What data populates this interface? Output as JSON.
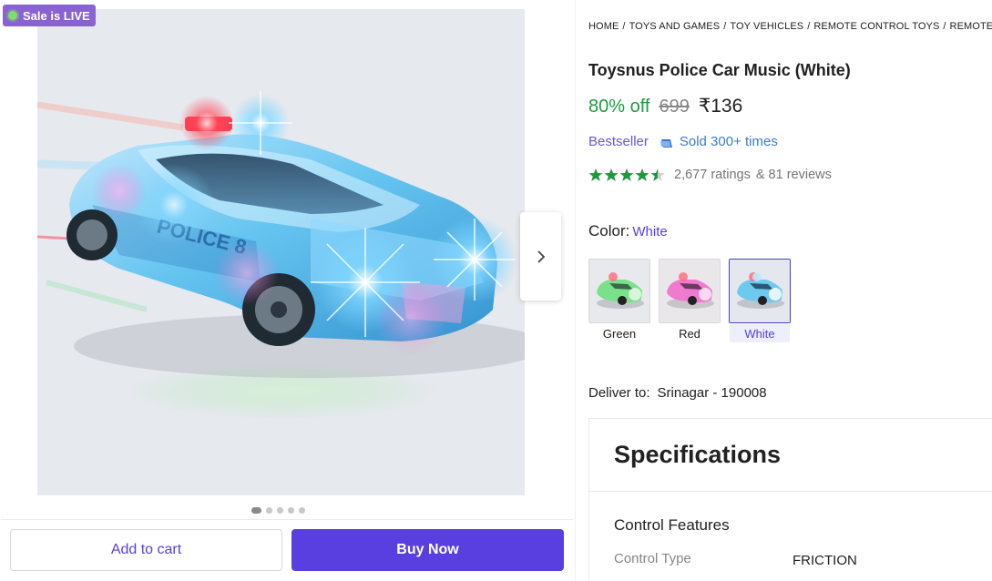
{
  "sale_badge": "Sale is LIVE",
  "gallery": {
    "image_alt": "Toysnus Police Car Music (White)",
    "image_text": "POLICE 8",
    "dots_count": 5,
    "active_dot": 0
  },
  "actions": {
    "add_to_cart": "Add to cart",
    "buy_now": "Buy Now"
  },
  "breadcrumb": [
    "HOME",
    "TOYS AND GAMES",
    "TOY VEHICLES",
    "REMOTE CONTROL TOYS",
    "REMOTE CO"
  ],
  "product": {
    "title": "Toysnus Police Car Music (White)",
    "discount": "80% off",
    "mrp": "699",
    "price": "₹136",
    "bestseller": "Bestseller",
    "sold": "Sold 300+ times",
    "rating_stars": 4.5,
    "ratings": "2,677 ratings",
    "reviews": "& 81 reviews"
  },
  "color": {
    "label": "Color:",
    "selected": "White",
    "options": [
      {
        "label": "Green",
        "tint": "#7be08a"
      },
      {
        "label": "Red",
        "tint": "#f07ad0"
      },
      {
        "label": "White",
        "tint": "#6ec9f0"
      }
    ]
  },
  "delivery": {
    "label": "Deliver to:",
    "location": "Srinagar - 190008"
  },
  "specifications": {
    "title": "Specifications",
    "section": "Control Features",
    "rows": [
      {
        "key": "Control Type",
        "value": "FRICTION"
      }
    ]
  },
  "colors": {
    "brand": "#5a3fe0",
    "discount_green": "#1b9b3e",
    "star_green": "#1b9b3e",
    "sale_badge": "#8a63d2"
  }
}
